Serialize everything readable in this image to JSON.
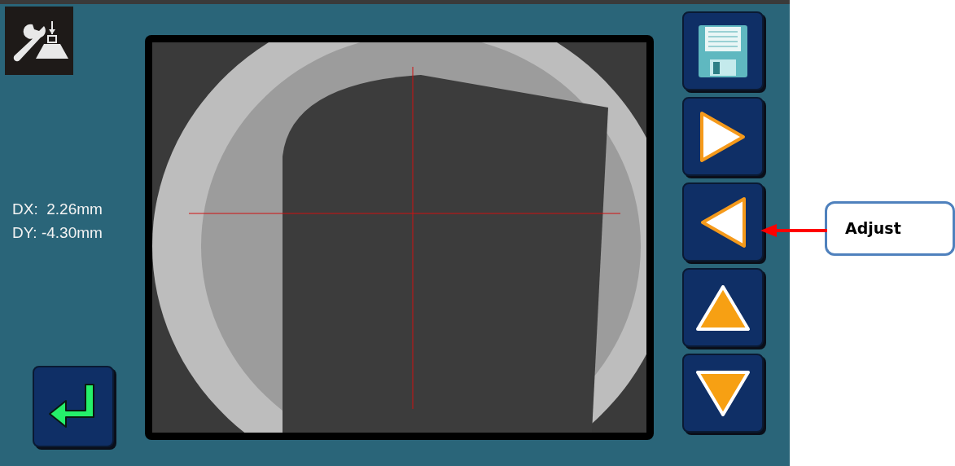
{
  "readout": [
    "DX:  2.26mm",
    "DY: -4.30mm"
  ],
  "side_buttons": [
    {
      "kind": "save"
    },
    {
      "kind": "right"
    },
    {
      "kind": "left"
    },
    {
      "kind": "up"
    },
    {
      "kind": "down"
    }
  ],
  "callout": {
    "text": "Adjust"
  }
}
